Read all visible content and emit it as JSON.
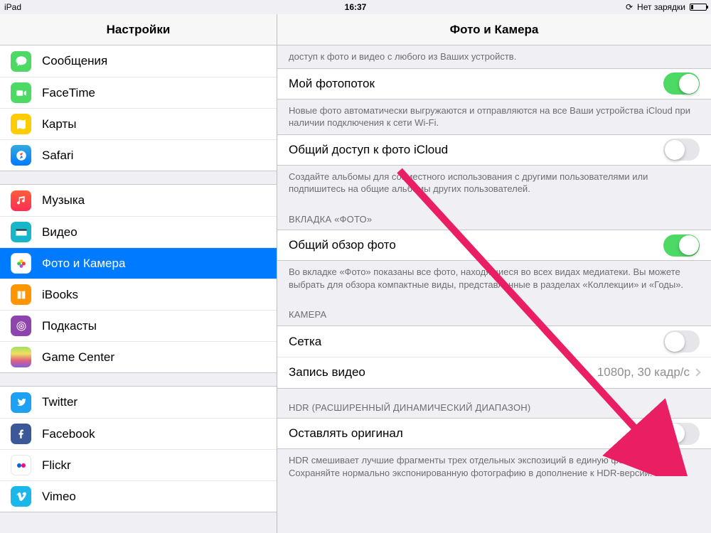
{
  "statusbar": {
    "device": "iPad",
    "time": "16:37",
    "charge_text": "Нет зарядки"
  },
  "sidebar": {
    "title": "Настройки",
    "group1": [
      "Сообщения",
      "FaceTime",
      "Карты",
      "Safari"
    ],
    "group2": [
      "Музыка",
      "Видео",
      "Фото и Камера",
      "iBooks",
      "Подкасты",
      "Game Center"
    ],
    "group3": [
      "Twitter",
      "Facebook",
      "Flickr",
      "Vimeo"
    ]
  },
  "detail": {
    "title": "Фото и Камера",
    "top_footer": "доступ к фото и видео с любого из Ваших устройств.",
    "photostream": {
      "label": "Мой фотопоток",
      "on": true,
      "footer": "Новые фото автоматически выгружаются и отправляются на все Ваши устройства iCloud при наличии подключения к сети Wi-Fi."
    },
    "sharing": {
      "label": "Общий доступ к фото iCloud",
      "on": false,
      "footer": "Создайте альбомы для совместного использования с другими пользователями или подпишитесь на общие альбомы других пользователей."
    },
    "photostab": {
      "header": "ВКЛАДКА «ФОТО»",
      "label": "Общий обзор фото",
      "on": true,
      "footer": "Во вкладке «Фото» показаны все фото, находящиеся во всех видах медиатеки. Вы можете выбрать для обзора компактные виды, представленные в разделах «Коллекции» и «Годы»."
    },
    "camera": {
      "header": "КАМЕРА",
      "grid_label": "Сетка",
      "grid_on": false,
      "record_label": "Запись видео",
      "record_value": "1080p, 30 кадр/с"
    },
    "hdr": {
      "header": "HDR (РАСШИРЕННЫЙ ДИНАМИЧЕСКИЙ ДИАПАЗОН)",
      "label": "Оставлять оригинал",
      "on": false,
      "footer": "HDR смешивает лучшие фрагменты трех отдельных экспозиций в единую фотографию. Сохраняйте нормально экспонированную фотографию в дополнение к HDR-версии."
    }
  }
}
